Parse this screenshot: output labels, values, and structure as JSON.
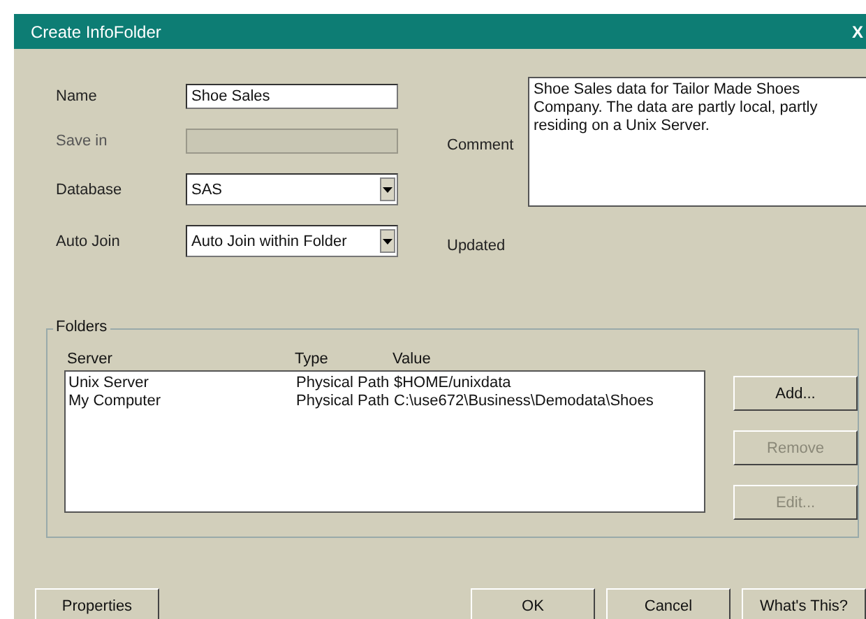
{
  "window": {
    "title": "Create InfoFolder",
    "close": "X"
  },
  "fields": [
    {
      "label": "Name",
      "kind": "text",
      "value": "Shoe Sales",
      "disabled": false
    },
    {
      "label": "Save in",
      "kind": "text",
      "disabled": true
    },
    {
      "label": "Database",
      "kind": "combo",
      "value": "SAS",
      "disabled": false
    },
    {
      "label": "Auto Join",
      "kind": "combo",
      "value": "Auto Join within Folder",
      "disabled": false
    }
  ],
  "comment": {
    "label": "Comment",
    "value": "Shoe Sales data for Tailor Made Shoes Company. The data are partly local, partly residing on a Unix Server."
  },
  "updated": {
    "label": "Updated"
  },
  "folders": {
    "title": "Folders",
    "columns": [
      "Server",
      "Type",
      "Value"
    ],
    "rows": [
      [
        "Unix Server",
        "Physical Path",
        "$HOME/unixdata"
      ],
      [
        "My Computer",
        "Physical Path",
        "C:\\use672\\Business\\Demodata\\Shoes"
      ]
    ]
  },
  "side_buttons": [
    {
      "label": "Add...",
      "disabled": false
    },
    {
      "label": "Remove",
      "disabled": true
    },
    {
      "label": "Edit...",
      "disabled": true
    }
  ],
  "bottom_buttons": [
    {
      "label": "Properties"
    },
    {
      "label": "OK"
    },
    {
      "label": "Cancel"
    },
    {
      "label": "What's This?"
    }
  ]
}
